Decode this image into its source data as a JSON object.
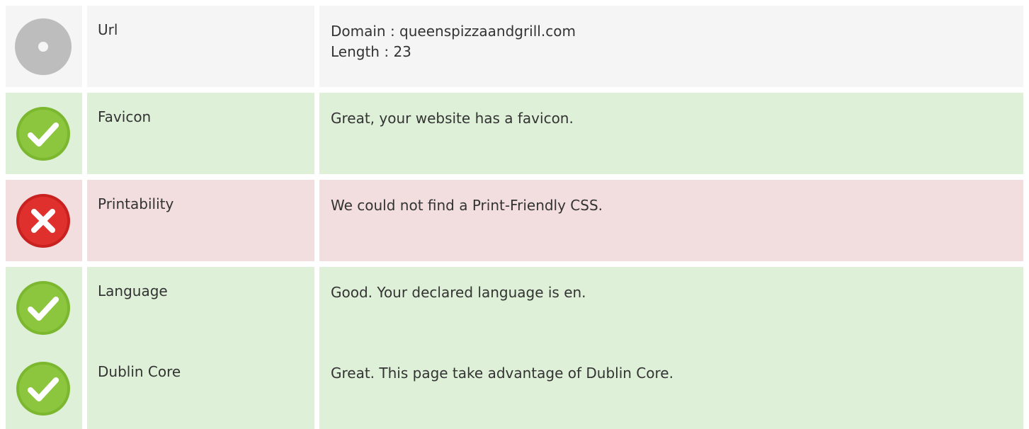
{
  "rows": [
    {
      "status": "info",
      "icon": "neutral-dot-icon",
      "name": "Url",
      "lines": [
        "Domain : queenspizzaandgrill.com",
        "Length : 23"
      ]
    },
    {
      "status": "pass",
      "icon": "checkmark-icon",
      "name": "Favicon",
      "lines": [
        "Great, your website has a favicon."
      ]
    },
    {
      "status": "fail",
      "icon": "cross-icon",
      "name": "Printability",
      "lines": [
        "We could not find a Print-Friendly CSS."
      ]
    },
    {
      "status": "pass",
      "icon": "checkmark-icon",
      "name": "Language",
      "lines": [
        "Good. Your declared language is en."
      ]
    },
    {
      "status": "pass",
      "icon": "checkmark-icon",
      "name": "Dublin Core",
      "lines": [
        "Great. This page take advantage of Dublin Core."
      ]
    }
  ],
  "colors": {
    "pass_background": "#dff0d8",
    "fail_background": "#f2dede",
    "info_background": "#f5f5f5",
    "pass_icon": "#8cc63f",
    "fail_icon": "#e0302e",
    "info_icon": "#bdbdbd"
  }
}
